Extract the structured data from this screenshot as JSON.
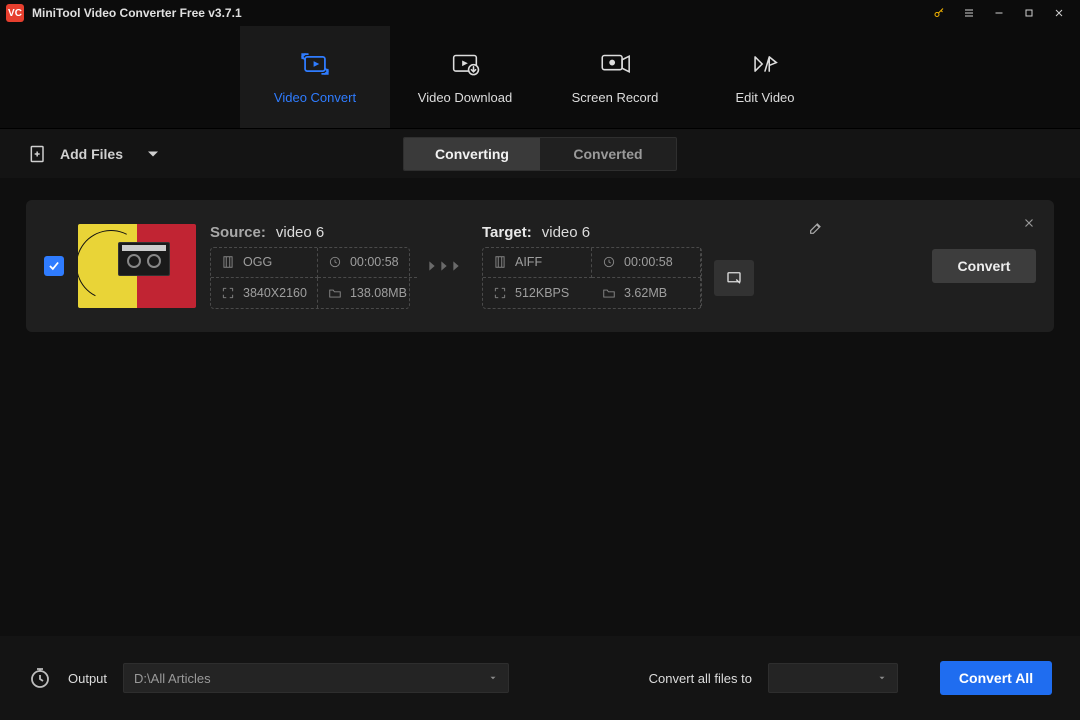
{
  "app": {
    "title": "MiniTool Video Converter Free v3.7.1",
    "logo_text": "VC"
  },
  "nav": {
    "items": [
      {
        "label": "Video Convert"
      },
      {
        "label": "Video Download"
      },
      {
        "label": "Screen Record"
      },
      {
        "label": "Edit Video"
      }
    ]
  },
  "toolbar": {
    "add_files": "Add Files"
  },
  "subtabs": {
    "converting": "Converting",
    "converted": "Converted"
  },
  "task": {
    "source_label": "Source:",
    "source_name": "video 6",
    "target_label": "Target:",
    "target_name": "video 6",
    "src": {
      "format": "OGG",
      "duration": "00:00:58",
      "resolution": "3840X2160",
      "size": "138.08MB"
    },
    "tgt": {
      "format": "AIFF",
      "duration": "00:00:58",
      "bitrate": "512KBPS",
      "size": "3.62MB"
    },
    "convert_btn": "Convert"
  },
  "bottom": {
    "output_label": "Output",
    "output_path": "D:\\All Articles",
    "convert_all_label": "Convert all files to",
    "convert_all_value": "",
    "convert_all_btn": "Convert All"
  }
}
